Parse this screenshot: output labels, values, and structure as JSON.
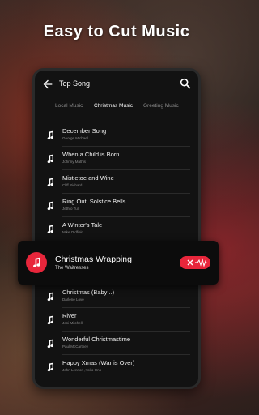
{
  "headline": "Easy to Cut Music",
  "topbar": {
    "title": "Top Song"
  },
  "tabs": [
    {
      "label": "Local Music",
      "active": false
    },
    {
      "label": "Christmas Music",
      "active": true
    },
    {
      "label": "Greeting Music",
      "active": false
    }
  ],
  "songs": [
    {
      "title": "December Song",
      "artist": "George Michael"
    },
    {
      "title": "When a Child is Born",
      "artist": "Johnny Mathis"
    },
    {
      "title": "Mistletoe and Wine",
      "artist": "Cliff Richard"
    },
    {
      "title": "Ring Out, Solstice Bells",
      "artist": "Jethro Tull"
    },
    {
      "title": "A Winter's Tale",
      "artist": "Mike Oldfield"
    },
    {
      "title": "Christmas (Baby ..)",
      "artist": "Darlene Love"
    },
    {
      "title": "River",
      "artist": "Joni Mitchell"
    },
    {
      "title": "Wonderful Christmastime",
      "artist": "Paul McCartney"
    },
    {
      "title": "Happy Xmas (War is Over)",
      "artist": "John Lennon ,Yoko Ono"
    }
  ],
  "selected": {
    "title": "Christmas Wrapping",
    "artist": "The Waitresses"
  },
  "colors": {
    "accent": "#e8263b"
  },
  "icons": [
    "back-arrow-icon",
    "search-icon",
    "music-note-icon",
    "cut-icon"
  ]
}
